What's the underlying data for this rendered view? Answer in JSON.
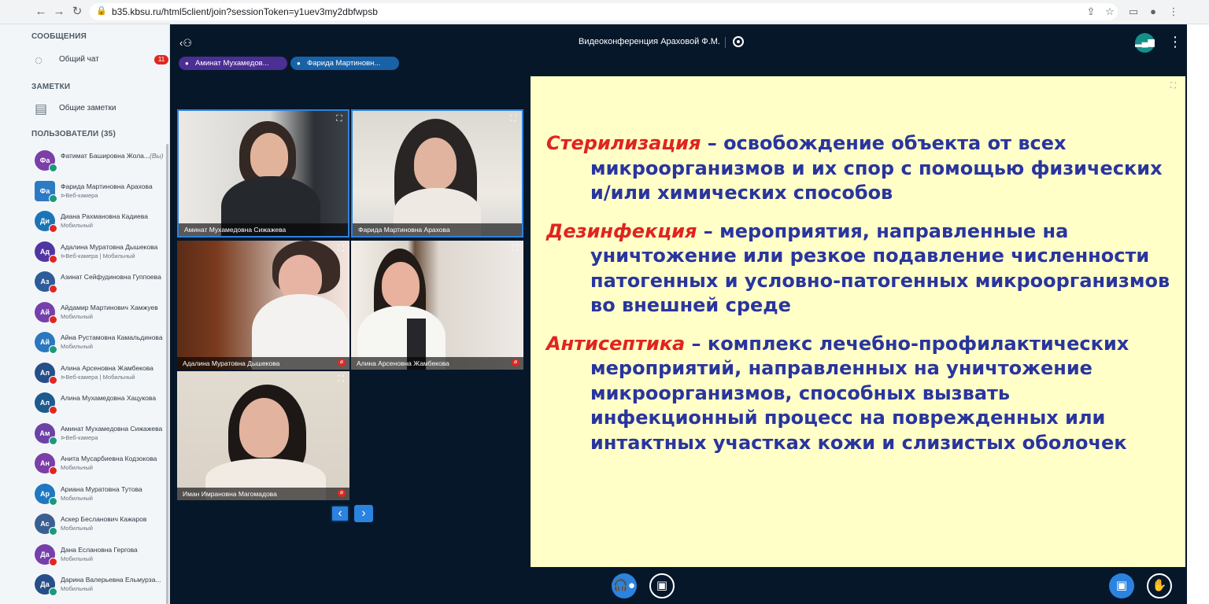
{
  "browser": {
    "url": "b35.kbsu.ru/html5client/join?sessionToken=y1uev3my2dbfwpsb",
    "icons": [
      "back-arrow",
      "forward-arrow",
      "reload",
      "lock",
      "share",
      "bookmark",
      "reader",
      "profile",
      "more"
    ]
  },
  "sidebar": {
    "messages_title": "СООБЩЕНИЯ",
    "public_chat_label": "Общий чат",
    "unread_count": "11",
    "notes_title": "ЗАМЕТКИ",
    "shared_notes_label": "Общие заметки",
    "users_title": "ПОЛЬЗОВАТЕЛИ (35)",
    "users": [
      {
        "initials": "Фа",
        "name": "Фатимат Башировна Жола...",
        "you": "(Вы)",
        "sub": "",
        "color": "#7b3fa7",
        "status": "green",
        "shape": "round"
      },
      {
        "initials": "Фа",
        "name": "Фарида Мартиновна Арахова",
        "you": "",
        "sub": "⊳Веб-камера",
        "color": "#2d7ac4",
        "status": "green",
        "shape": "square"
      },
      {
        "initials": "Ди",
        "name": "Диана Рахмановна Кадиева",
        "you": "",
        "sub": "Мобильный",
        "color": "#1b74b8",
        "status": "red",
        "shape": "round"
      },
      {
        "initials": "Ад",
        "name": "Адалина Муратовна Дышекова",
        "you": "",
        "sub": "⊳Веб-камера | Мобильный",
        "color": "#5135a1",
        "status": "red",
        "shape": "round"
      },
      {
        "initials": "Аз",
        "name": "Азинат Сейфудиновна Гуппоева",
        "you": "",
        "sub": "",
        "color": "#2e5b99",
        "status": "red",
        "shape": "round"
      },
      {
        "initials": "Ай",
        "name": "Айдамир Мартинович Хамжуев",
        "you": "",
        "sub": "Мобильный",
        "color": "#7540aa",
        "status": "red",
        "shape": "round"
      },
      {
        "initials": "Ай",
        "name": "Айна Рустамовна Камальдинова",
        "you": "",
        "sub": "Мобильный",
        "color": "#2b78bf",
        "status": "green",
        "shape": "round"
      },
      {
        "initials": "Ал",
        "name": "Алина Арсеновна Жамбекова",
        "you": "",
        "sub": "⊳Веб-камера | Мобильный",
        "color": "#264f8a",
        "status": "red",
        "shape": "round"
      },
      {
        "initials": "Ал",
        "name": "Алина Мухамедовна Хацукова",
        "you": "",
        "sub": "",
        "color": "#1d5a8e",
        "status": "red",
        "shape": "round"
      },
      {
        "initials": "Ам",
        "name": "Аминат Мухамедовна Сижажева",
        "you": "",
        "sub": "⊳Веб-камера",
        "color": "#6d42a6",
        "status": "green",
        "shape": "round"
      },
      {
        "initials": "Ан",
        "name": "Анита Мусарбиевна Кодзокова",
        "you": "",
        "sub": "Мобильный",
        "color": "#7b3fa7",
        "status": "red",
        "shape": "round"
      },
      {
        "initials": "Ар",
        "name": "Ариана Муратовна Тутова",
        "you": "",
        "sub": "Мобильный",
        "color": "#1f78c1",
        "status": "green",
        "shape": "round"
      },
      {
        "initials": "Ас",
        "name": "Аскер Бесланович Кажаров",
        "you": "",
        "sub": "Мобильный",
        "color": "#3a5f92",
        "status": "green",
        "shape": "round"
      },
      {
        "initials": "Да",
        "name": "Дана Еслановна Гергова",
        "you": "",
        "sub": "Мобильный",
        "color": "#7540aa",
        "status": "red",
        "shape": "round"
      },
      {
        "initials": "Да",
        "name": "Дарина Валерьевна Ельмурза...",
        "you": "",
        "sub": "Мобильный",
        "color": "#264f8a",
        "status": "green",
        "shape": "round"
      }
    ]
  },
  "conference": {
    "title": "Видеоконференция Араховой Ф.М.",
    "talkers": [
      "Аминат Мухамедов...",
      "Фарида Мартиновн..."
    ],
    "tiles": [
      {
        "name": "Аминат Мухамедовна Сижажева",
        "selected": true,
        "muted": false
      },
      {
        "name": "Фарида Мартиновна Арахова",
        "selected": true,
        "muted": false
      },
      {
        "name": "Адалина Муратовна Дышекова",
        "selected": false,
        "muted": true
      },
      {
        "name": "Алина Арсеновна Жамбекова",
        "selected": false,
        "muted": true
      },
      {
        "name": "Иман Имрановна Магомадова",
        "selected": false,
        "muted": true
      }
    ],
    "slide": {
      "term1": "Стерилизация",
      "def1": " – освобождение объекта от всех микроорганизмов и их спор с помощью физических и/или химических способов",
      "term2": "Дезинфекция",
      "def2": " – мероприятия, направленные на уничтожение или резкое подавление численности патогенных и условно-патогенных микроорганизмов во внешней среде",
      "term3": "Антисептика",
      "def3": " – комплекс лечебно-профилактических мероприятий, направленных на уничтожение микроорганизмов, способных вызвать инфекционный процесс на поврежденных или интактных участках кожи и слизистых оболочек"
    }
  }
}
